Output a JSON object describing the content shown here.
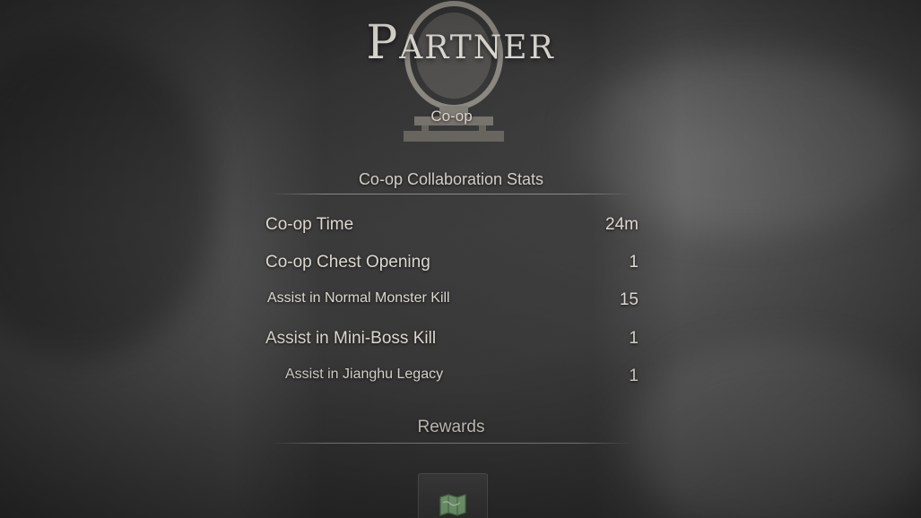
{
  "screen": {
    "title": "Partner",
    "subtitle": "Co-op"
  },
  "stats": {
    "header": "Co-op Collaboration Stats",
    "rows": [
      {
        "label": "Co-op Time",
        "value": "24m"
      },
      {
        "label": "Co-op Chest Opening",
        "value": "1"
      },
      {
        "label": "Assist in Normal Monster Kill",
        "value": "15"
      },
      {
        "label": "Assist in Mini-Boss Kill",
        "value": "1"
      },
      {
        "label": "Assist in Jianghu Legacy",
        "value": "1"
      }
    ]
  },
  "rewards": {
    "header": "Rewards",
    "items": [
      {
        "icon": "map-scroll-icon"
      }
    ]
  },
  "colors": {
    "text": "#dcd8d0",
    "reward_icon": "#8fbf8a"
  }
}
